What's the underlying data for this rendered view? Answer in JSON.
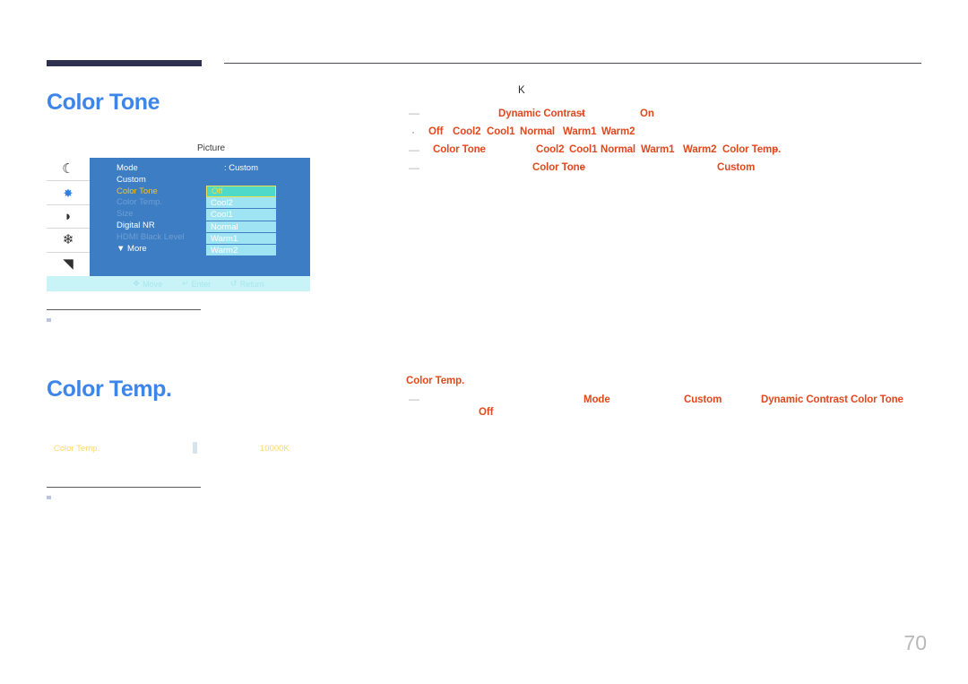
{
  "page": {
    "number": "70",
    "accent_blue": "#3d85e8",
    "accent_orange": "#e0481e",
    "header_bar_color": "#2e3050"
  },
  "sections": [
    {
      "id": "color-tone",
      "heading": "Color Tone"
    },
    {
      "id": "color-temp",
      "heading": "Color Temp."
    }
  ],
  "osd": {
    "title": "Picture",
    "rail_icons": [
      {
        "name": "moon-icon",
        "glyph": "☾"
      },
      {
        "name": "brightness-icon",
        "glyph": "✸"
      },
      {
        "name": "sound-icon",
        "glyph": "◗"
      },
      {
        "name": "gear-icon",
        "glyph": "✸"
      },
      {
        "name": "network-icon",
        "glyph": "◥"
      }
    ],
    "menu_rows": [
      {
        "label": "Mode",
        "value": ": Custom",
        "state": "normal"
      },
      {
        "label": "Custom",
        "value": "",
        "state": "normal"
      },
      {
        "label": "Color Tone",
        "value": ":",
        "state": "selected"
      },
      {
        "label": "Color Temp.",
        "value": ":",
        "state": "disabled"
      },
      {
        "label": "Size",
        "value": ":",
        "state": "disabled"
      },
      {
        "label": "Digital NR",
        "value": ":",
        "state": "normal"
      },
      {
        "label": "HDMI Black Level",
        "value": ":",
        "state": "disabled"
      },
      {
        "label": "▼ More",
        "value": "",
        "state": "normal"
      }
    ],
    "dropdown": {
      "options": [
        "Off",
        "Cool2",
        "Cool1",
        "Normal",
        "Warm1",
        "Warm2"
      ],
      "selected": "Off"
    },
    "footer": [
      {
        "icon": "❖",
        "label": "Move"
      },
      {
        "icon": "↵",
        "label": "Enter"
      },
      {
        "icon": "↺",
        "label": "Return"
      }
    ]
  },
  "color_temp_figure": {
    "label": "Color Temp.",
    "value": "10000K"
  },
  "body": {
    "color_tone": {
      "marker_k": "K",
      "line1": {
        "dash": "—",
        "t1": "Dynamic Contrast",
        "t1b": "–",
        "t2": "On"
      },
      "line2": {
        "bullet": "·",
        "options": [
          "Off",
          "Cool2",
          "Cool1",
          "Normal",
          "Warm1",
          "Warm2"
        ]
      },
      "line3": {
        "dash": "—",
        "t1": "Color Tone",
        "opts": [
          "Cool2",
          "Cool1",
          "Normal",
          "Warm1"
        ],
        "t2": "Warm2",
        "t3": "Color Temp.",
        "t3b": "–"
      },
      "line4": {
        "dash": "—",
        "t1": "Color Tone",
        "t1b": "–",
        "t2": "Custom"
      }
    },
    "color_temp": {
      "subheading": "Color Temp.",
      "line1": {
        "dash": "—",
        "t1": "Mode",
        "t2": "Custom",
        "t3": "Dynamic Contrast",
        "t4": "Color Tone"
      },
      "line2": {
        "t1": "Off"
      }
    }
  }
}
